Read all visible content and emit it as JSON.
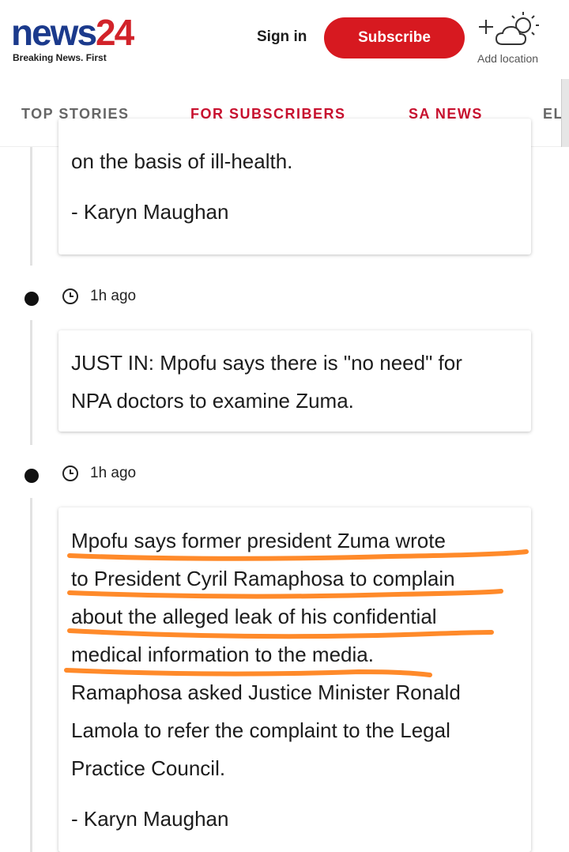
{
  "header": {
    "logo_news": "news",
    "logo_num": "24",
    "tagline": "Breaking News. First",
    "signin_label": "Sign in",
    "subscribe_label": "Subscribe",
    "weather_label": "Add location"
  },
  "tabs": [
    {
      "label": "TOP STORIES"
    },
    {
      "label": "FOR SUBSCRIBERS"
    },
    {
      "label": "SA NEWS"
    },
    {
      "label": "ELE"
    }
  ],
  "entries": [
    {
      "body_lines": [
        "on the basis of ill-health."
      ],
      "author": "- Karyn Maughan"
    },
    {
      "time": "1h ago",
      "body_lines": [
        "JUST IN: Mpofu says there is \"no need\" for",
        "NPA doctors to examine Zuma."
      ]
    },
    {
      "time": "1h ago",
      "body_lines": [
        "Mpofu says former president Zuma wrote",
        "to President Cyril Ramaphosa to complain",
        "about the alleged leak of his confidential",
        "medical information to the media.",
        "Ramaphosa asked Justice Minister Ronald",
        "Lamola to refer the complaint to the Legal",
        "Practice Council."
      ],
      "author": "- Karyn Maughan"
    }
  ],
  "colors": {
    "brand_blue": "#1b3a8c",
    "brand_red": "#d2232a",
    "subscribe_red": "#d71920",
    "active_tab": "#c8102e",
    "highlight_orange": "#ff8a2a"
  },
  "icons": {
    "weather": "sun-cloud-add-icon",
    "clock": "clock-icon"
  }
}
